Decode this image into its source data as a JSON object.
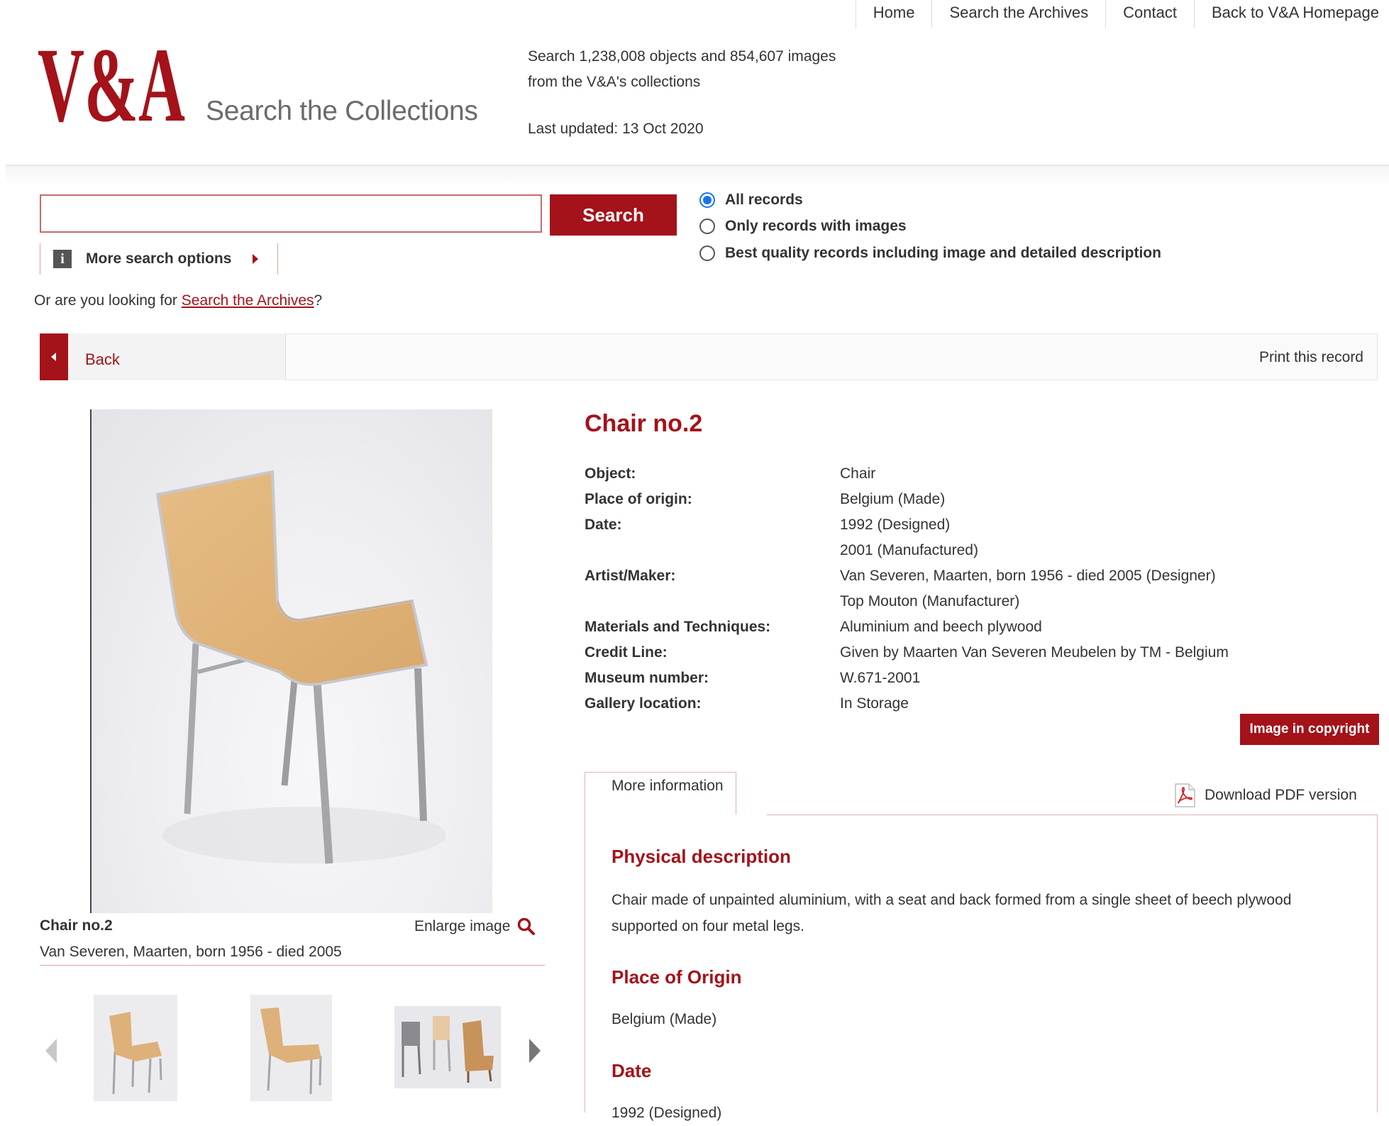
{
  "topnav": {
    "items": [
      "Home",
      "Search the Archives",
      "Contact",
      "Back to V&A Homepage"
    ]
  },
  "header": {
    "logo_text": "V&A",
    "subtitle": "Search the Collections",
    "stats_line1": "Search 1,238,008 objects and 854,607 images",
    "stats_line2": "from the V&A's collections",
    "last_updated": "Last updated: 13 Oct 2020"
  },
  "search": {
    "query": "",
    "button_label": "Search",
    "more_options": "More search options",
    "radios": [
      {
        "label": "All records",
        "checked": true
      },
      {
        "label": "Only records with images",
        "checked": false
      },
      {
        "label": "Best quality records including image and detailed description",
        "checked": false
      }
    ],
    "archives_prefix": "Or are you looking for ",
    "archives_link": "Search the Archives",
    "archives_suffix": "?"
  },
  "recordbar": {
    "back_label": "Back",
    "print_label": "Print this record"
  },
  "image": {
    "caption_title": "Chair no.2",
    "caption_maker": "Van Severen, Maarten, born 1956 - died 2005",
    "enlarge_label": "Enlarge image",
    "icons": {
      "enlarge": "magnifier-icon",
      "prev": "chevron-left-icon",
      "next": "chevron-right-icon"
    }
  },
  "record": {
    "title": "Chair no.2",
    "fields": [
      {
        "label": "Object:",
        "values": [
          "Chair"
        ]
      },
      {
        "label": "Place of origin:",
        "values": [
          "Belgium (Made)"
        ]
      },
      {
        "label": "Date:",
        "values": [
          "1992 (Designed)",
          "2001 (Manufactured)"
        ]
      },
      {
        "label": "Artist/Maker:",
        "values": [
          "Van Severen, Maarten, born 1956 - died 2005 (Designer)",
          "Top Mouton (Manufacturer)"
        ]
      },
      {
        "label": "Materials and Techniques:",
        "values": [
          "Aluminium and beech plywood"
        ]
      },
      {
        "label": "Credit Line:",
        "values": [
          "Given by Maarten Van Severen Meubelen by TM - Belgium"
        ]
      },
      {
        "label": "Museum number:",
        "values": [
          "W.671-2001"
        ]
      },
      {
        "label": "Gallery location:",
        "values": [
          "In Storage"
        ]
      }
    ],
    "copyright_label": "Image in copyright"
  },
  "tabs": {
    "active": "More information",
    "pdf_label": "Download PDF version"
  },
  "details": {
    "physical_heading": "Physical description",
    "physical_line1": "Chair made of unpainted aluminium, with a seat and back formed from a single sheet of beech plywood",
    "physical_line2": "supported on four metal legs.",
    "origin_heading": "Place of Origin",
    "origin_text": "Belgium (Made)",
    "date_heading": "Date",
    "date_text": "1992 (Designed)"
  },
  "colors": {
    "brand_red": "#a4121a",
    "radio_blue": "#1a73e8"
  }
}
